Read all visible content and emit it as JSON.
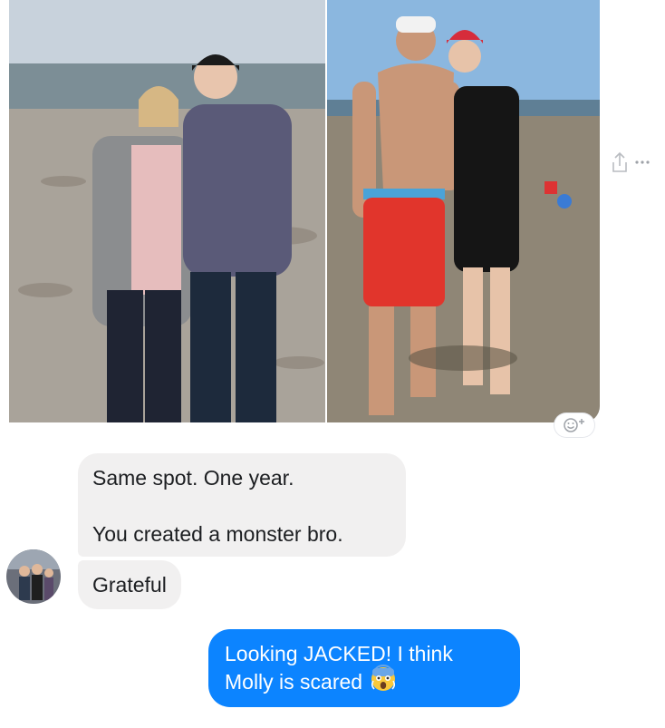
{
  "thread": {
    "shared_photo": {
      "alt_left": "Couple standing on beach",
      "alt_right": "Couple standing on beach one year later"
    },
    "actions": {
      "share_icon": "share-icon",
      "more_icon": "more-icon",
      "react_icon": "add-reaction-icon"
    },
    "incoming": {
      "message_1_line_1": "Same spot. One year.",
      "message_1_line_2": "You created a monster bro.",
      "message_2": "Grateful",
      "avatar_icon": "avatar"
    },
    "outgoing": {
      "message_line_1": "Looking JACKED!  I think",
      "message_line_2": "Molly is scared",
      "emoji": "fearful-face-emoji"
    }
  },
  "colors": {
    "incoming_bubble": "#f1f0f0",
    "outgoing_bubble": "#0c84ff",
    "text_dark": "#1c1e21",
    "icon_gray": "#b9bcc1"
  }
}
